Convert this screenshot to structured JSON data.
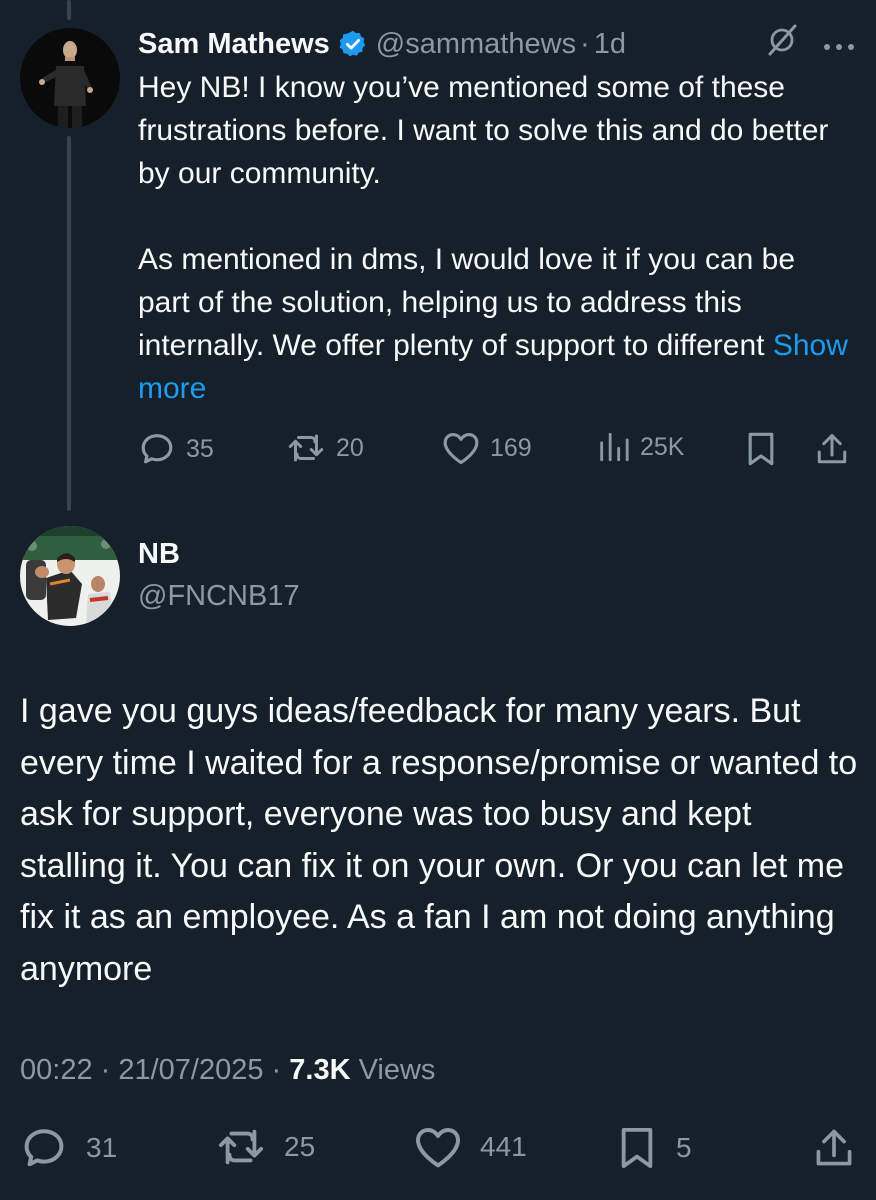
{
  "reply": {
    "display_name": "Sam Mathews",
    "verified_icon": "verified-badge-icon",
    "handle": "@sammathews",
    "separator": "·",
    "time": "1d",
    "grok_icon": "grok-icon",
    "more_icon": "more-icon",
    "paragraphs": [
      "Hey NB! I know you’ve mentioned some of these frustrations before. I want to solve this and do better by our community.",
      " As mentioned in dms, I would love it if you can be part of the solution, helping us to address this internally. We offer plenty of support to different"
    ],
    "show_more": "Show more",
    "actions": {
      "replies": "35",
      "reposts": "20",
      "likes": "169",
      "views": "25K"
    }
  },
  "main_tweet": {
    "display_name": "NB",
    "handle": "@FNCNB17",
    "text": "I gave you guys ideas/feedback for many years. But every time I waited for a response/promise or wanted to ask for support, everyone was too busy and kept stalling it. You can fix it on your own. Or you can let me fix it as an employee. As a fan I am not doing anything anymore",
    "timestamp": "00:22 · 21/07/2025 · ",
    "views_count": "7.3K",
    "views_label": " Views",
    "actions": {
      "replies": "31",
      "reposts": "25",
      "likes": "441",
      "bookmarks": "5"
    }
  },
  "colors": {
    "background": "#15202b",
    "text_primary": "#f7f9f9",
    "text_secondary": "#8b98a5",
    "link": "#1d9bf0",
    "thread_line": "#38444d"
  }
}
